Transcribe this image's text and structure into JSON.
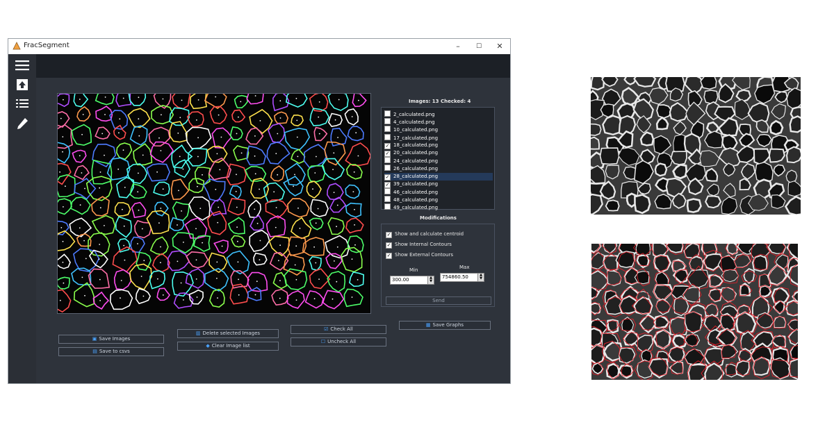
{
  "window": {
    "title": "FracSegment",
    "min_label": "–",
    "max_label": "☐",
    "close_label": "✕"
  },
  "sidebar": {
    "icons": [
      "hamburger-menu-icon",
      "upload-icon",
      "list-icon",
      "pencil-icon"
    ]
  },
  "list_panel": {
    "header": "Images: 13 Checked: 4",
    "items": [
      {
        "label": "2_calculated.png",
        "checked": false,
        "selected": false
      },
      {
        "label": "4_calculated.png",
        "checked": false,
        "selected": false
      },
      {
        "label": "10_calculated.png",
        "checked": false,
        "selected": false
      },
      {
        "label": "17_calculated.png",
        "checked": false,
        "selected": false
      },
      {
        "label": "18_calculated.png",
        "checked": true,
        "selected": false
      },
      {
        "label": "20_calculated.png",
        "checked": true,
        "selected": false
      },
      {
        "label": "24_calculated.png",
        "checked": false,
        "selected": false
      },
      {
        "label": "26_calculated.png",
        "checked": false,
        "selected": false
      },
      {
        "label": "28_calculated.png",
        "checked": true,
        "selected": true
      },
      {
        "label": "39_calculated.png",
        "checked": true,
        "selected": false
      },
      {
        "label": "46_calculated.png",
        "checked": false,
        "selected": false
      },
      {
        "label": "48_calculated.png",
        "checked": false,
        "selected": false
      },
      {
        "label": "49_calculated.png",
        "checked": false,
        "selected": false
      }
    ]
  },
  "modifications": {
    "header": "Modifications",
    "options": [
      {
        "label": "Show and calculate centroid",
        "checked": true
      },
      {
        "label": "Show Internal Contours",
        "checked": true
      },
      {
        "label": "Show External Contours",
        "checked": true
      }
    ],
    "min_label": "Min",
    "max_label": "Max",
    "min_value": "300.00",
    "max_value": "754860.50",
    "send_label": "Send"
  },
  "buttons": {
    "save_images": "Save Images",
    "save_csvs": "Save to csvs",
    "delete_selected": "Delete selected Images",
    "clear_list": "Clear Image list",
    "check_all": "Check All",
    "uncheck_all": "Uncheck All",
    "save_graphs": "Save Graphs"
  },
  "colors": {
    "window_bg": "#2e333b",
    "accent": "#4aa3ff",
    "contour_red": "#e0202a"
  }
}
